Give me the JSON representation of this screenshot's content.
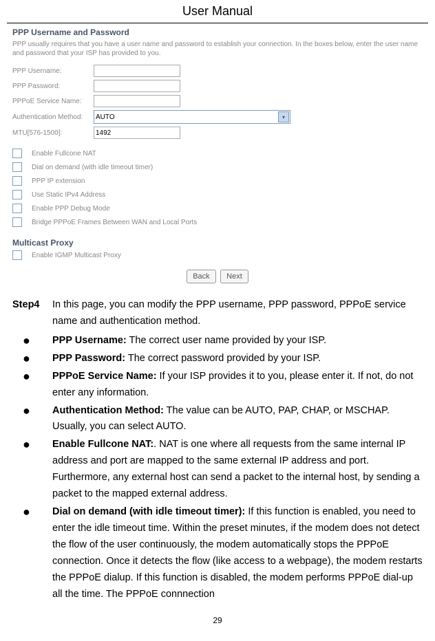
{
  "header": "User Manual",
  "ui": {
    "section1_title": "PPP Username and Password",
    "section1_desc": "PPP usually requires that you have a user name and password to establish your connection. In the boxes below, enter the user name and password that your ISP has provided to you.",
    "fields": {
      "username_label": "PPP Username:",
      "username_value": "",
      "password_label": "PPP Password:",
      "password_value": "",
      "service_label": "PPPoE Service Name:",
      "service_value": "",
      "auth_label": "Authentication Method:",
      "auth_value": "AUTO",
      "mtu_label": "MTU[576-1500]:",
      "mtu_value": "1492"
    },
    "checkboxes": [
      "Enable Fullcone NAT",
      "Dial on demand (with idle timeout timer)",
      "PPP IP extension",
      "Use Static IPv4 Address",
      "Enable PPP Debug Mode",
      "Bridge PPPoE Frames Between WAN and Local Ports"
    ],
    "section2_title": "Multicast Proxy",
    "multicast_checkbox": "Enable IGMP Multicast Proxy",
    "buttons": {
      "back": "Back",
      "next": "Next"
    }
  },
  "content": {
    "step_label": "Step4",
    "step_text": "In this page, you can modify the PPP username, PPP password, PPPoE service name and authentication method.",
    "bullets": [
      {
        "bold": "PPP Username:",
        "text": " The correct user name provided by your ISP."
      },
      {
        "bold": "PPP Password:",
        "text": " The correct password provided by your ISP."
      },
      {
        "bold": "PPPoE Service Name:",
        "text": " If your ISP provides it to you, please enter it. If not, do not enter any information."
      },
      {
        "bold": "Authentication Method:",
        "text": " The value can be AUTO, PAP, CHAP, or MSCHAP. Usually, you can select AUTO."
      },
      {
        "bold": "Enable Fullcone NAT:",
        "text": ". NAT is one where all requests from the same internal IP address and port are mapped to the same external IP address and port. Furthermore, any external host can send a packet to the internal host, by sending a packet to the mapped external address."
      },
      {
        "bold": "Dial on demand (with idle timeout timer):",
        "text": " If this function is enabled, you need to enter the idle timeout time. Within the preset minutes, if the modem does not detect the flow of the user continuously, the modem automatically stops the PPPoE connection. Once it detects the flow (like access to a webpage), the modem restarts the PPPoE dialup. If this function is disabled, the modem performs PPPoE dial-up all the time. The PPPoE connnection"
      }
    ]
  },
  "page_number": "29"
}
